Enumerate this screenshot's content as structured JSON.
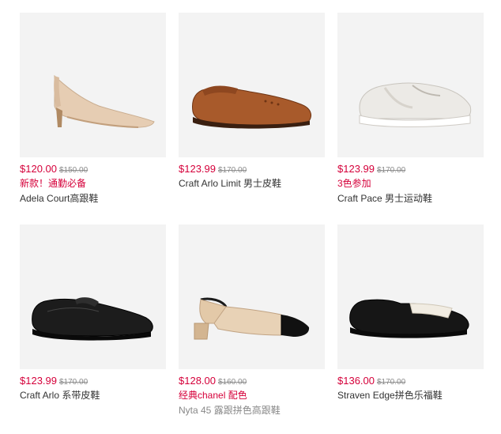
{
  "products": [
    {
      "price": "$120.00",
      "original_price": "$150.00",
      "promo": "新款！通勤必备",
      "name": "Adela Court高跟鞋",
      "icon": "beige-pump-shoe-icon"
    },
    {
      "price": "$123.99",
      "original_price": "$170.00",
      "promo": "",
      "name": "Craft Arlo Limit 男士皮鞋",
      "icon": "tan-brogue-shoe-icon"
    },
    {
      "price": "$123.99",
      "original_price": "$170.00",
      "promo": "3色参加",
      "name": "Craft Pace 男士运动鞋",
      "icon": "white-sneaker-icon"
    },
    {
      "price": "$123.99",
      "original_price": "$170.00",
      "promo": "",
      "name": "Craft Arlo 系带皮鞋",
      "icon": "black-derby-shoe-icon"
    },
    {
      "price": "$128.00",
      "original_price": "$160.00",
      "promo": "经典chanel 配色",
      "name": "Nyta 45 露跟拼色高跟鞋",
      "icon": "two-tone-slingback-icon"
    },
    {
      "price": "$136.00",
      "original_price": "$170.00",
      "promo": "",
      "name": "Straven Edge拼色乐福鞋",
      "icon": "two-tone-loafer-icon"
    }
  ],
  "colors": {
    "price": "#d5003a",
    "tile_bg": "#f3f3f3",
    "strike": "#8c8c8c"
  }
}
